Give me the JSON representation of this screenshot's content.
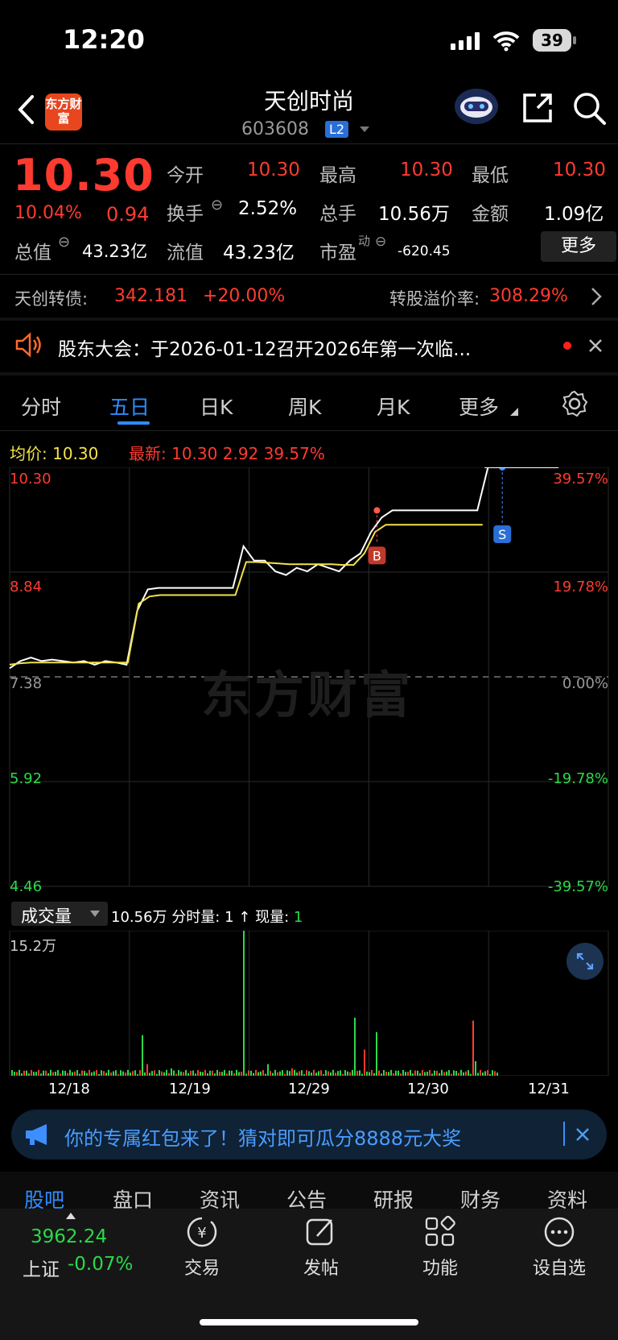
{
  "status_bar": {
    "time": "12:20",
    "battery": "39"
  },
  "header": {
    "title": "天创时尚",
    "code": "603608",
    "level_badge": "L2",
    "logo_text": "东方财富"
  },
  "quote": {
    "price": "10.30",
    "change_pct": "10.04%",
    "change": "0.94",
    "open_label": "今开",
    "open": "10.30",
    "high_label": "最高",
    "high": "10.30",
    "low_label": "最低",
    "low": "10.30",
    "turnover_label": "换手",
    "turnover": "2.52%",
    "volume_label": "总手",
    "volume": "10.56万",
    "amount_label": "金额",
    "amount": "1.09亿",
    "mcap_label": "总值",
    "mcap": "43.23亿",
    "float_label": "流值",
    "float": "43.23亿",
    "pe_label": "市盈",
    "pe_sup": "动",
    "pe": "-620.45",
    "more_button": "更多"
  },
  "bond": {
    "name": "天创转债:",
    "price": "342.181",
    "change": "+20.00%",
    "premium_label": "转股溢价率:",
    "premium": "308.29%"
  },
  "notice": {
    "text": "股东大会：于2026-01-12召开2026年第一次临..."
  },
  "tabs": [
    "分时",
    "五日",
    "日K",
    "周K",
    "月K",
    "更多"
  ],
  "chart_header": {
    "avg_label": "均价:",
    "avg": "10.30",
    "latest_label": "最新:",
    "latest": "10.30",
    "latest_change": "2.92",
    "latest_pct": "39.57%"
  },
  "chart_data": {
    "type": "line",
    "x": [
      "12/18",
      "12/19",
      "12/29",
      "12/30",
      "12/31"
    ],
    "y_left_ticks": [
      "10.30",
      "8.84",
      "7.38",
      "5.92",
      "4.46"
    ],
    "y_right_ticks": [
      "39.57%",
      "19.78%",
      "0.00%",
      "-19.78%",
      "-39.57%"
    ],
    "ylim": [
      4.46,
      10.3
    ],
    "prev_close": 7.38,
    "watermark": "东方财富",
    "series": [
      {
        "values": [
          7.5,
          7.6,
          7.65,
          7.6,
          7.62,
          7.6,
          7.58,
          7.6,
          7.55,
          7.6,
          7.58,
          7.55,
          8.3,
          8.6,
          8.62,
          8.62,
          8.62,
          8.62,
          8.62,
          8.62,
          8.62,
          8.62,
          9.2,
          9.0,
          9.0,
          8.85,
          8.8,
          8.9,
          8.85,
          8.95,
          8.9,
          8.85,
          9.0,
          9.1,
          9.4,
          9.6,
          9.7,
          9.7,
          9.7,
          9.7,
          9.7,
          9.7,
          9.7,
          9.7,
          9.7,
          10.3,
          10.3,
          10.3,
          10.3,
          10.3
        ]
      },
      {
        "values": [
          7.55,
          7.57,
          7.58,
          7.58,
          7.58,
          7.58,
          7.58,
          7.58,
          7.58,
          7.58,
          7.58,
          7.58,
          8.4,
          8.5,
          8.52,
          8.52,
          8.52,
          8.52,
          8.52,
          8.52,
          8.52,
          8.52,
          8.98,
          8.98,
          8.97,
          8.96,
          8.95,
          8.95,
          8.95,
          8.95,
          8.95,
          8.94,
          8.94,
          9.1,
          9.4,
          9.5,
          9.5,
          9.5,
          9.5,
          9.5,
          9.5,
          9.5,
          9.5,
          9.5,
          9.5
        ]
      }
    ],
    "markers": [
      {
        "label": "B"
      },
      {
        "label": "S"
      }
    ],
    "volume": {
      "label": "成交量",
      "total": "10.56万",
      "period_label": "分时量:",
      "period_value": "1",
      "now_label": "现量:",
      "now_value": "1",
      "max_tick": "15.2万"
    }
  },
  "banner": {
    "text": "你的专属红包来了！猜对即可瓜分8888元大奖"
  },
  "subtabs": [
    "股吧",
    "盘口",
    "资讯",
    "公告",
    "研报",
    "财务",
    "资料"
  ],
  "bottom_nav": {
    "index_value": "3962.24",
    "index_name": "上证",
    "index_change": "-0.07%",
    "items": [
      "交易",
      "发帖",
      "功能",
      "设自选"
    ]
  },
  "colors": {
    "up": "#ff3b30",
    "down": "#2bd94a",
    "avg_line": "#f3e24a",
    "accent": "#2f8cff"
  }
}
